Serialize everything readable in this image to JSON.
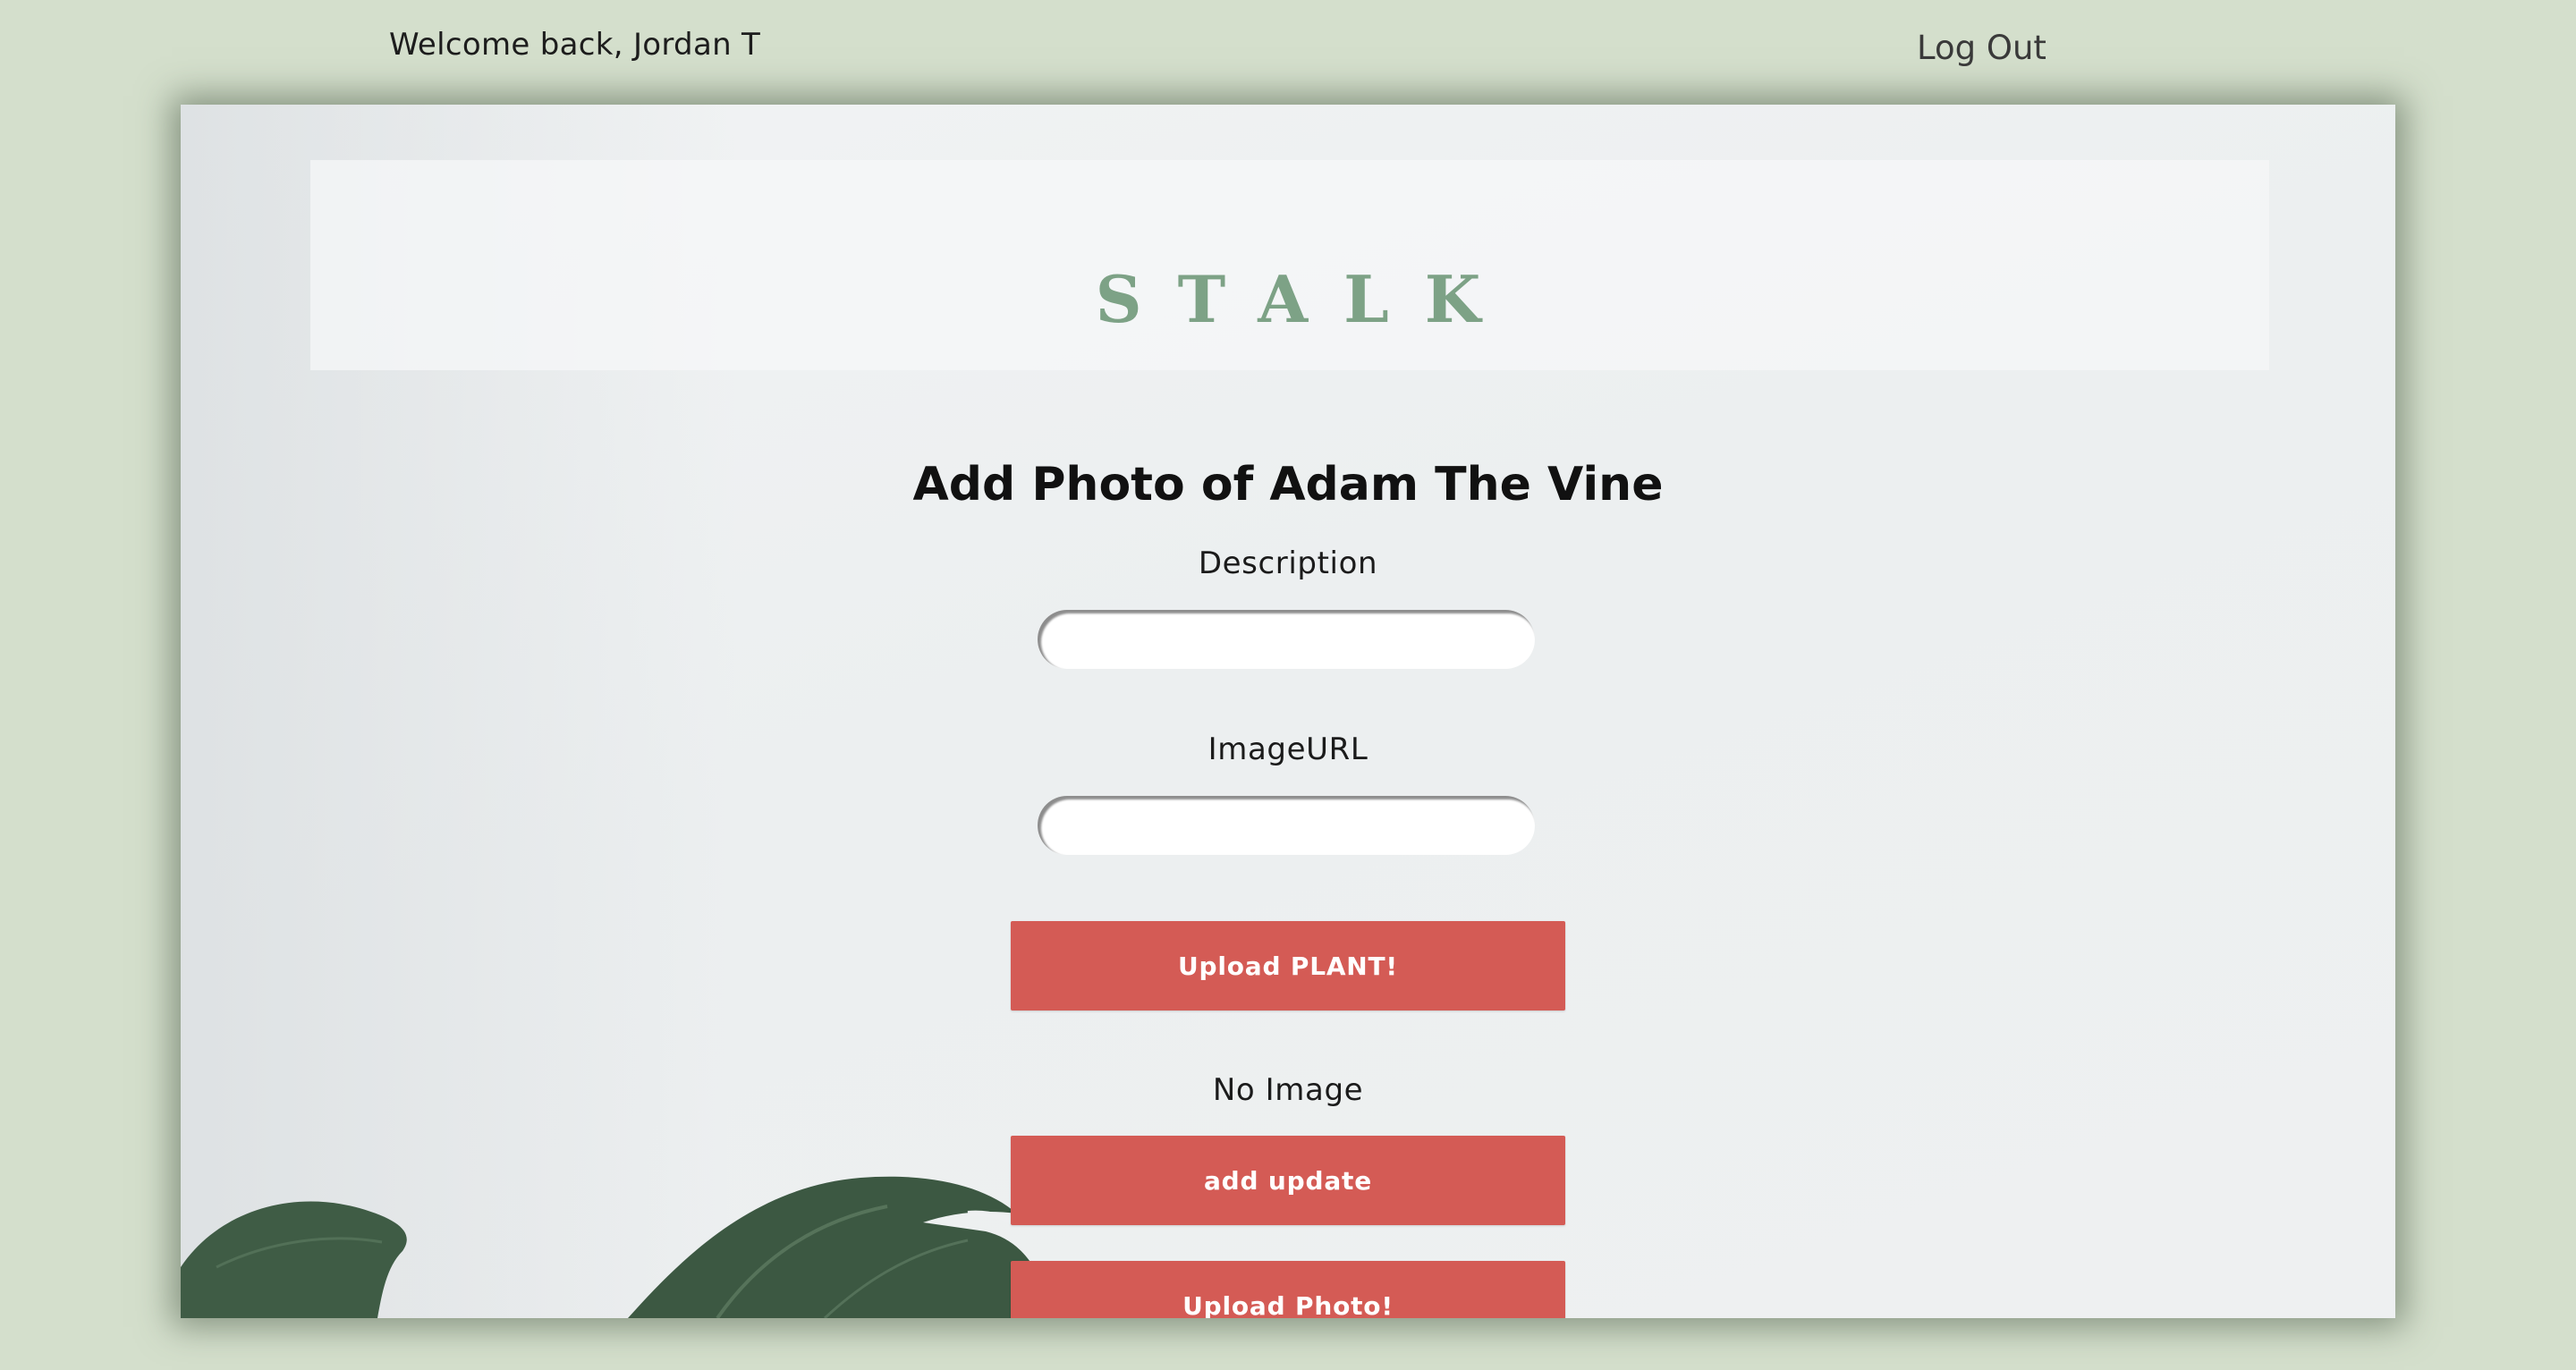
{
  "header": {
    "welcome_text": "Welcome back, Jordan T",
    "logout_label": "Log Out"
  },
  "brand": {
    "logo_text": "STALK",
    "logo_color": "#7da286"
  },
  "form": {
    "title": "Add Photo of Adam The Vine",
    "description_label": "Description",
    "description_value": "",
    "image_url_label": "ImageURL",
    "image_url_value": "",
    "upload_plant_label": "Upload PLANT!",
    "no_image_text": "No Image",
    "add_update_label": "add update",
    "upload_photo_label": "Upload Photo!"
  },
  "colors": {
    "page_background": "#d4dfcc",
    "button": "#d45b55",
    "leaf": "#3e5a43"
  },
  "icons": {
    "decoration": "monstera-leaf"
  }
}
